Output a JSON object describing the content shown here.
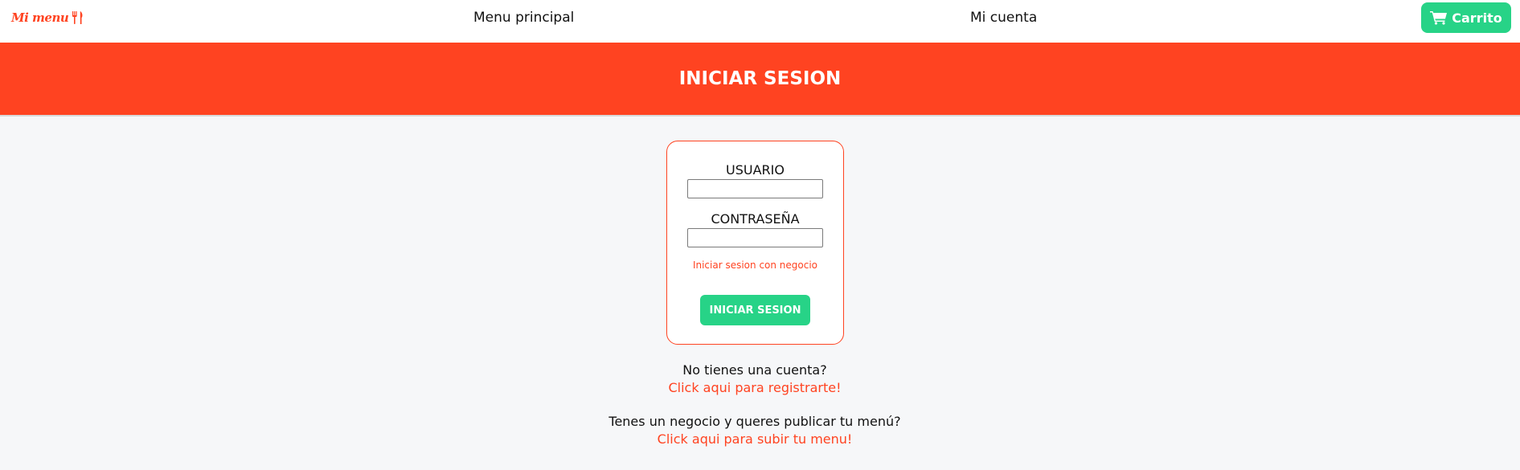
{
  "navbar": {
    "brand": "Mi menu",
    "brand_icon": "fork-knife-icon",
    "menu_principal": "Menu principal",
    "mi_cuenta": "Mi cuenta",
    "cart_label": "Carrito",
    "cart_icon": "cart-icon"
  },
  "banner": {
    "title": "INICIAR SESION"
  },
  "login": {
    "user_label": "USUARIO",
    "user_value": "",
    "password_label": "CONTRASEÑA",
    "password_value": "",
    "business_link": "Iniciar sesion con negocio",
    "submit_label": "INICIAR SESION"
  },
  "footer_links": {
    "no_account_text": "No tienes una cuenta?",
    "register_link": "Click aqui para registrarte!",
    "business_text": "Tenes un negocio y queres publicar tu menú?",
    "upload_menu_link": "Click aqui para subir tu menu!"
  },
  "colors": {
    "brand_red": "#ff4321",
    "accent_green": "#27d387",
    "background": "#f6f7f9"
  }
}
